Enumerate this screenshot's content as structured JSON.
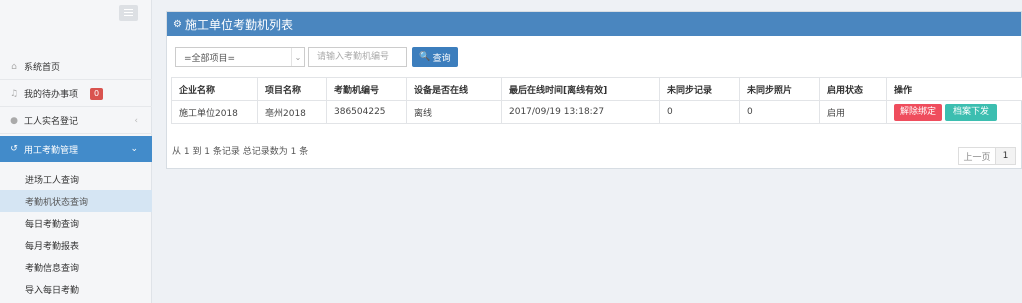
{
  "sidebar": {
    "items": [
      {
        "label": "系统首页",
        "icon": "home-icon"
      },
      {
        "label": "我的待办事项",
        "icon": "bell-icon",
        "badge": "0"
      },
      {
        "label": "工人实名登记",
        "icon": "user-icon"
      },
      {
        "label": "用工考勤管理",
        "icon": "history-icon"
      }
    ],
    "subitems": [
      "进场工人查询",
      "考勤机状态查询",
      "每日考勤查询",
      "每月考勤报表",
      "考勤信息查询",
      "导入每日考勤"
    ]
  },
  "panel": {
    "title": "施工单位考勤机列表",
    "project_select": "=全部项目=",
    "search_placeholder": "请输入考勤机编号",
    "query_label": "查询"
  },
  "table": {
    "headers": [
      "企业名称",
      "项目名称",
      "考勤机编号",
      "设备是否在线",
      "最后在线时间[离线有效]",
      "未同步记录",
      "未同步照片",
      "启用状态",
      "操作"
    ],
    "rows": [
      {
        "company": "施工单位2018",
        "project": "亳州2018",
        "machine_no": "386504225",
        "online": "离线",
        "last_online": "2017/09/19 13:18:27",
        "unsynced_records": "0",
        "unsynced_photos": "0",
        "status": "启用",
        "action_unbind": "解除绑定",
        "action_issue": "档案下发"
      }
    ]
  },
  "footer": {
    "summary": "从 1 到 1 条记录 总记录数为 1 条",
    "prev": "上一页",
    "page": "1"
  },
  "colors": {
    "accent": "#428bca",
    "header": "#4a86bf",
    "danger": "#ef4d5d",
    "teal": "#3cbeb0"
  }
}
